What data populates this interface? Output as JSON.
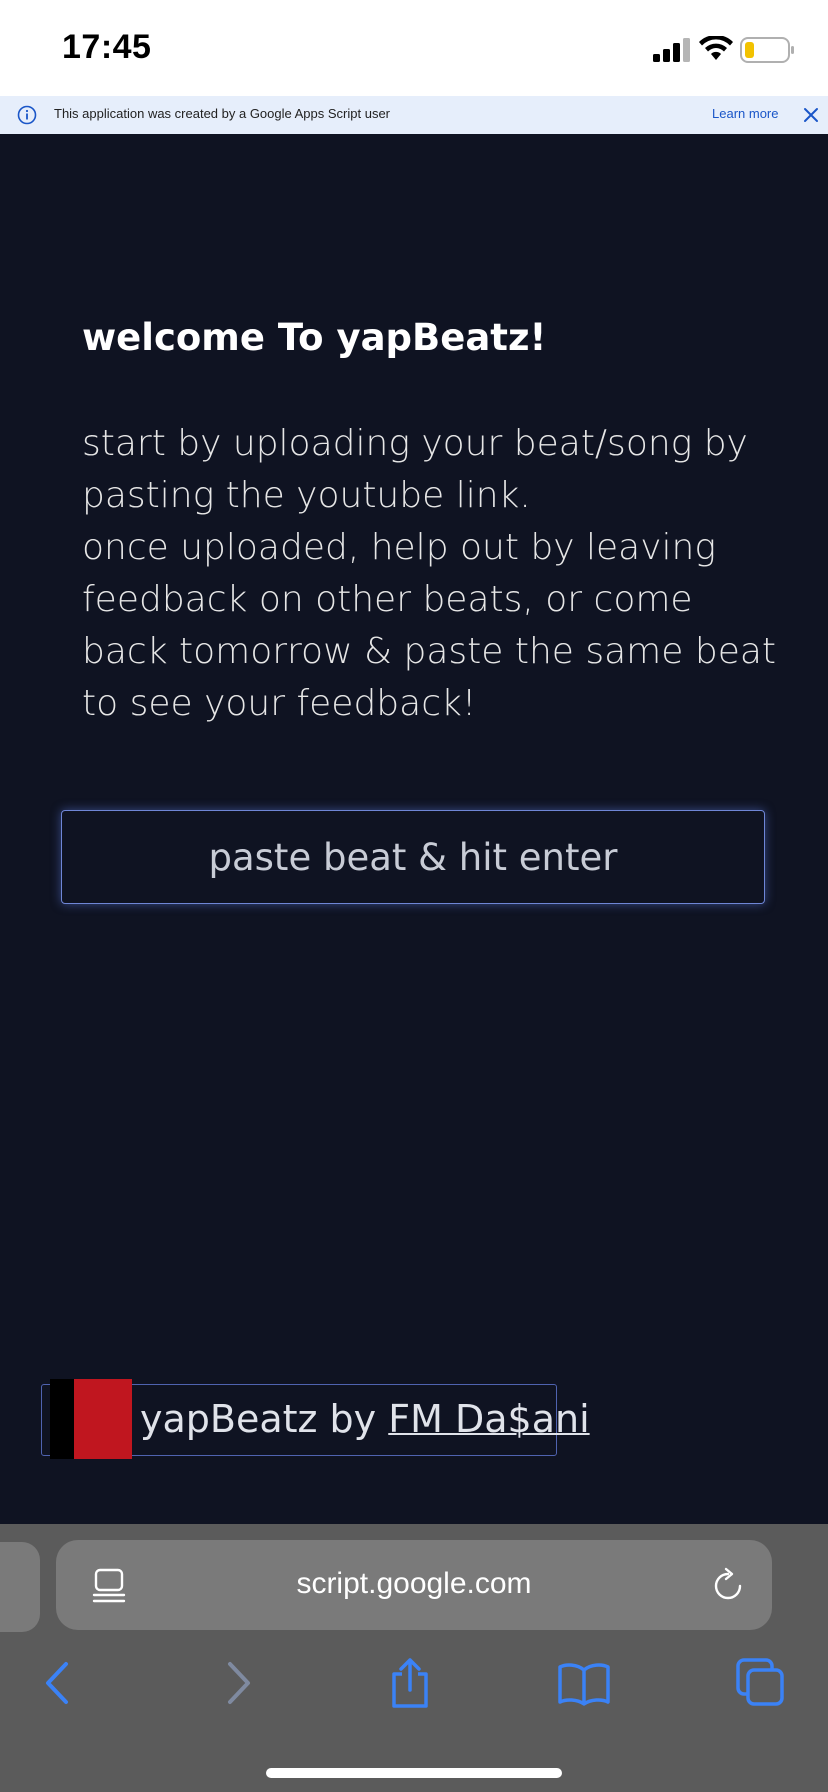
{
  "status_bar": {
    "time": "17:45",
    "icons": [
      "signal-icon",
      "wifi-icon",
      "battery-icon"
    ],
    "battery_color": "#f2c200"
  },
  "banner": {
    "icon": "info-icon",
    "text": "This application was created by a Google Apps Script user",
    "learn_more": "Learn more",
    "close_icon": "close-icon",
    "background": "#e6eefb",
    "link_color": "#1a56c8"
  },
  "main": {
    "background": "#0f1322",
    "title": "welcome To yapBeatz!",
    "intro_lines": [
      "start by uploading your beat/song by",
      "pasting the youtube link.",
      "once uploaded, help out by leaving",
      "feedback on other beats, or come",
      "back tomorrow & paste the same beat",
      "to see your feedback!"
    ],
    "input": {
      "placeholder": "paste beat & hit enter",
      "value": ""
    },
    "credit": {
      "prefix": "yapBeatz by ",
      "link": "FM Da$ani",
      "flag_colors": [
        "#000000",
        "#c0161f"
      ]
    }
  },
  "browser": {
    "url": "script.google.com",
    "toolbar": [
      "back-icon",
      "forward-icon",
      "share-icon",
      "bookmarks-icon",
      "tabs-icon"
    ],
    "accent": "#3b82f6"
  }
}
